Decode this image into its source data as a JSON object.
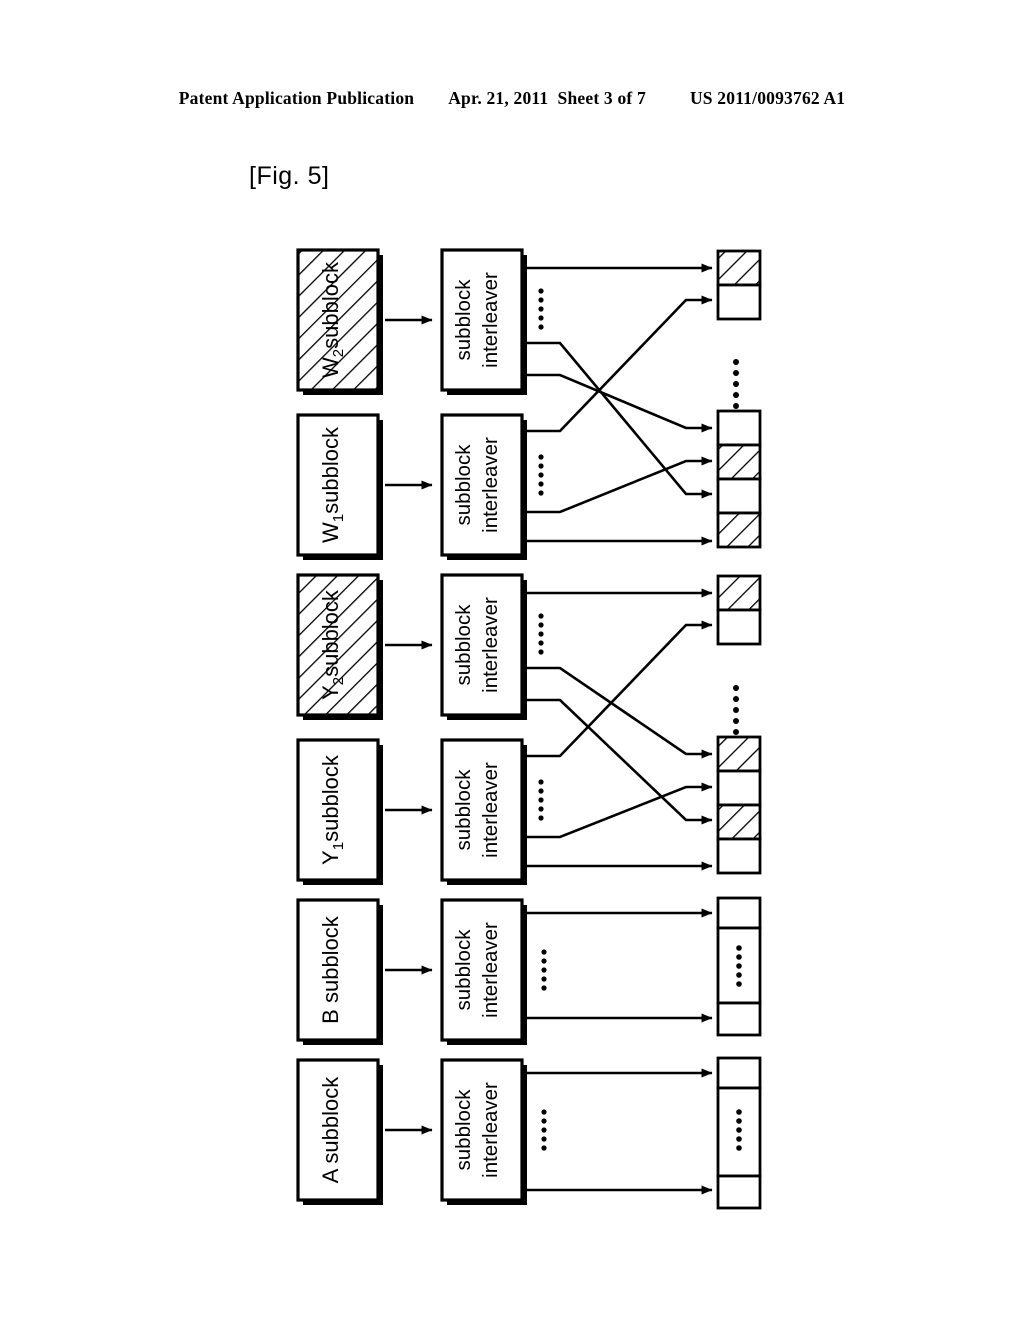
{
  "header": {
    "publication": "Patent Application Publication",
    "date_sheet": "Apr. 21, 2011  Sheet 3 of 7",
    "patent_number": "US 2011/0093762 A1"
  },
  "figure": {
    "label": "[Fig. 5]",
    "interleaver_label_line1": "subblock",
    "interleaver_label_line2": "interleaver",
    "colors": {
      "ink": "#000000",
      "paper": "#ffffff"
    },
    "rows": [
      {
        "id": "w2",
        "source_label": "W₂ subblock",
        "source_text_main": "subblock",
        "source_text_prefix": "W",
        "source_text_sub": "2",
        "hatched": true,
        "interleaver_outputs": 3
      },
      {
        "id": "w1",
        "source_label": "W₁ subblock",
        "source_text_main": "subblock",
        "source_text_prefix": "W",
        "source_text_sub": "1",
        "hatched": false,
        "interleaver_outputs": 3
      },
      {
        "id": "y2",
        "source_label": "Y₂ subblock",
        "source_text_main": "subblock",
        "source_text_prefix": "Y",
        "source_text_sub": "2",
        "hatched": true,
        "interleaver_outputs": 3
      },
      {
        "id": "y1",
        "source_label": "Y₁ subblock",
        "source_text_main": "subblock",
        "source_text_prefix": "Y",
        "source_text_sub": "1",
        "hatched": false,
        "interleaver_outputs": 3
      },
      {
        "id": "b",
        "source_label": "B subblock",
        "source_text_main": "B subblock",
        "source_text_prefix": "",
        "source_text_sub": "",
        "hatched": false,
        "interleaver_outputs": 2
      },
      {
        "id": "a",
        "source_label": "A subblock",
        "source_text_main": "A subblock",
        "source_text_prefix": "",
        "source_text_sub": "",
        "hatched": false,
        "interleaver_outputs": 2
      }
    ],
    "output_columns": [
      {
        "id": "out-w-upper",
        "cells": [
          "hatched",
          "plain"
        ]
      },
      {
        "id": "out-w-lower",
        "cells": [
          "plain",
          "hatched",
          "plain",
          "hatched"
        ]
      },
      {
        "id": "out-y-upper",
        "cells": [
          "hatched",
          "plain"
        ]
      },
      {
        "id": "out-y-lower",
        "cells": [
          "hatched",
          "plain",
          "hatched",
          "plain"
        ]
      },
      {
        "id": "out-b",
        "cells": [
          "plain",
          "ellipsis",
          "plain"
        ]
      },
      {
        "id": "out-a",
        "cells": [
          "plain",
          "ellipsis",
          "plain"
        ]
      }
    ],
    "ellipsis_glyph": "•"
  }
}
